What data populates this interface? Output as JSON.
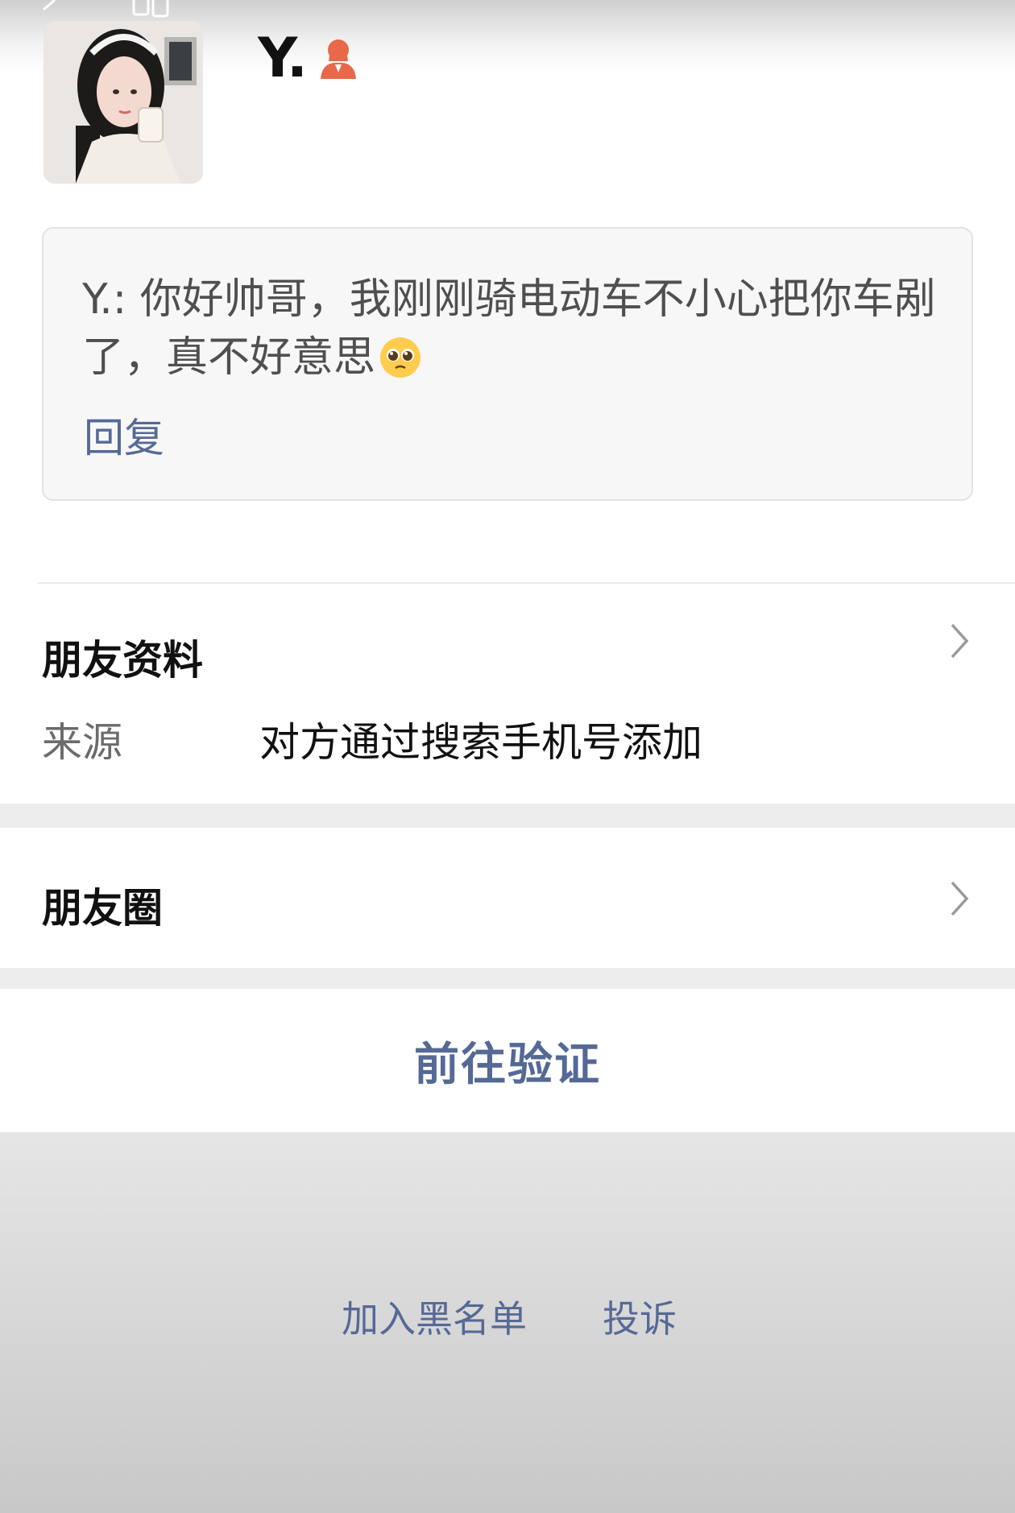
{
  "profile": {
    "name": "Y.",
    "avatar_icon": "avatar-photo",
    "gender_icon": "female-user-icon",
    "gender_color": "#e8694a"
  },
  "greeting": {
    "text": "Y.: 你好帅哥，我刚刚骑电动车不小心把你车剐了，真不好意思",
    "emoji_icon": "pleading-face-emoji",
    "reply_label": "回复"
  },
  "friend_info": {
    "title": "朋友资料",
    "source_label": "来源",
    "source_value": "对方通过搜索手机号添加"
  },
  "moments": {
    "title": "朋友圈"
  },
  "actions": {
    "verify_label": "前往验证",
    "blacklist_label": "加入黑名单",
    "report_label": "投诉"
  },
  "colors": {
    "link": "#566996",
    "background_gray": "#ededed"
  }
}
